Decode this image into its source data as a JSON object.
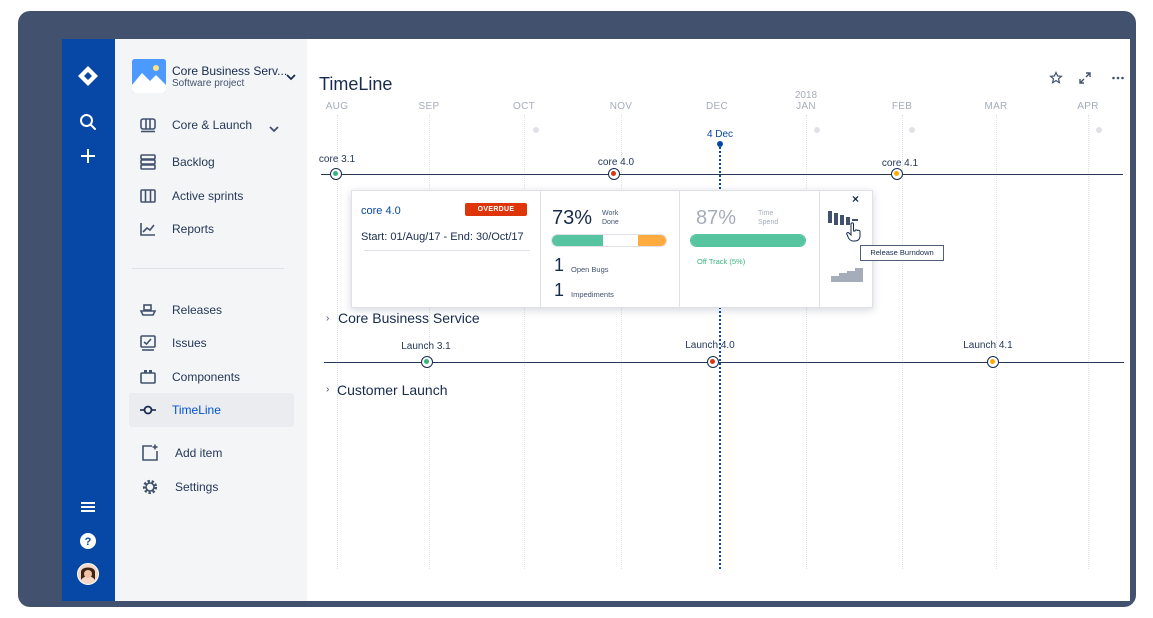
{
  "gnav": {
    "icons": [
      "jira-logo-icon",
      "search-icon",
      "plus-icon",
      "menu-icon",
      "help-icon",
      "avatar"
    ]
  },
  "sidebar": {
    "project": {
      "name": "Core Business Serv...",
      "type": "Software project"
    },
    "items": [
      {
        "label": "Core & Launch",
        "icon": "board-icon"
      },
      {
        "label": "Backlog",
        "icon": "backlog-icon"
      },
      {
        "label": "Active sprints",
        "icon": "sprint-board-icon"
      },
      {
        "label": "Reports",
        "icon": "reports-icon"
      },
      {
        "label": "Releases",
        "icon": "ship-icon"
      },
      {
        "label": "Issues",
        "icon": "issues-icon"
      },
      {
        "label": "Components",
        "icon": "components-icon"
      },
      {
        "label": "TimeLine",
        "icon": "timeline-icon",
        "active": true
      },
      {
        "label": "Add item",
        "icon": "add-item-icon"
      },
      {
        "label": "Settings",
        "icon": "settings-icon"
      }
    ]
  },
  "main": {
    "title": "TimeLine",
    "year": "2018",
    "months": [
      "AUG",
      "SEP",
      "OCT",
      "NOV",
      "DEC",
      "JAN",
      "FEB",
      "MAR",
      "APR"
    ],
    "today": "4 Dec",
    "releases_top": [
      {
        "label": "core 3.1",
        "status": "green"
      },
      {
        "label": "core 4.0",
        "status": "red"
      },
      {
        "label": "core 4.1",
        "status": "yellow"
      }
    ],
    "groups": [
      {
        "label": "Core Business Service"
      },
      {
        "label": "Customer Launch"
      }
    ],
    "releases_bottom": [
      {
        "label": "Launch 3.1",
        "status": "green"
      },
      {
        "label": "Launch 4.0",
        "status": "red"
      },
      {
        "label": "Launch 4.1",
        "status": "yellow"
      }
    ],
    "popup": {
      "name": "core 4.0",
      "badge": "OVERDUE",
      "dates": "Start: 01/Aug/17 - End: 30/Oct/17",
      "work_done": {
        "percent": "73%",
        "label": "Work Done",
        "progress": {
          "green": 0.45,
          "white": 0.3,
          "orange": 0.25
        }
      },
      "open_bugs": {
        "count": "1",
        "label": "Open Bugs"
      },
      "impediments": {
        "count": "1",
        "label": "Impediments"
      },
      "time_spend": {
        "percent": "87%",
        "label": "Time Spend",
        "progress": 1.0
      },
      "track": "Off Track (5%)",
      "tooltip": "Release Burndown",
      "colors": {
        "green": "#57c4a0",
        "orange": "#ffab3f",
        "red": "#de350b"
      }
    }
  }
}
